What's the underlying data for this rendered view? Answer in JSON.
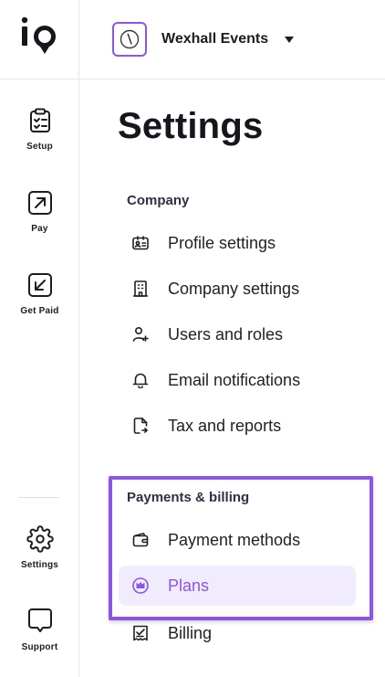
{
  "brand": {
    "logo_text": "io",
    "accent_color": "#8a55e8"
  },
  "sidebar": {
    "items": [
      {
        "label": "Setup",
        "icon": "clipboard-check-icon"
      },
      {
        "label": "Pay",
        "icon": "arrow-up-right-icon"
      },
      {
        "label": "Get Paid",
        "icon": "arrow-down-left-icon"
      },
      {
        "label": "Settings",
        "icon": "gear-icon"
      },
      {
        "label": "Support",
        "icon": "chat-bubble-icon"
      }
    ]
  },
  "header": {
    "org_name": "Wexhall Events",
    "org_icon": "compass-icon"
  },
  "page": {
    "title": "Settings"
  },
  "sections": {
    "company": {
      "title": "Company",
      "items": [
        {
          "label": "Profile settings",
          "icon": "id-card-icon"
        },
        {
          "label": "Company settings",
          "icon": "building-icon"
        },
        {
          "label": "Users and roles",
          "icon": "user-plus-icon"
        },
        {
          "label": "Email notifications",
          "icon": "bell-icon"
        },
        {
          "label": "Tax and reports",
          "icon": "document-icon"
        }
      ]
    },
    "billing": {
      "title": "Payments & billing",
      "items": [
        {
          "label": "Payment methods",
          "icon": "wallet-icon"
        },
        {
          "label": "Plans",
          "icon": "crown-icon",
          "active": true
        },
        {
          "label": "Billing",
          "icon": "receipt-icon"
        }
      ]
    }
  }
}
